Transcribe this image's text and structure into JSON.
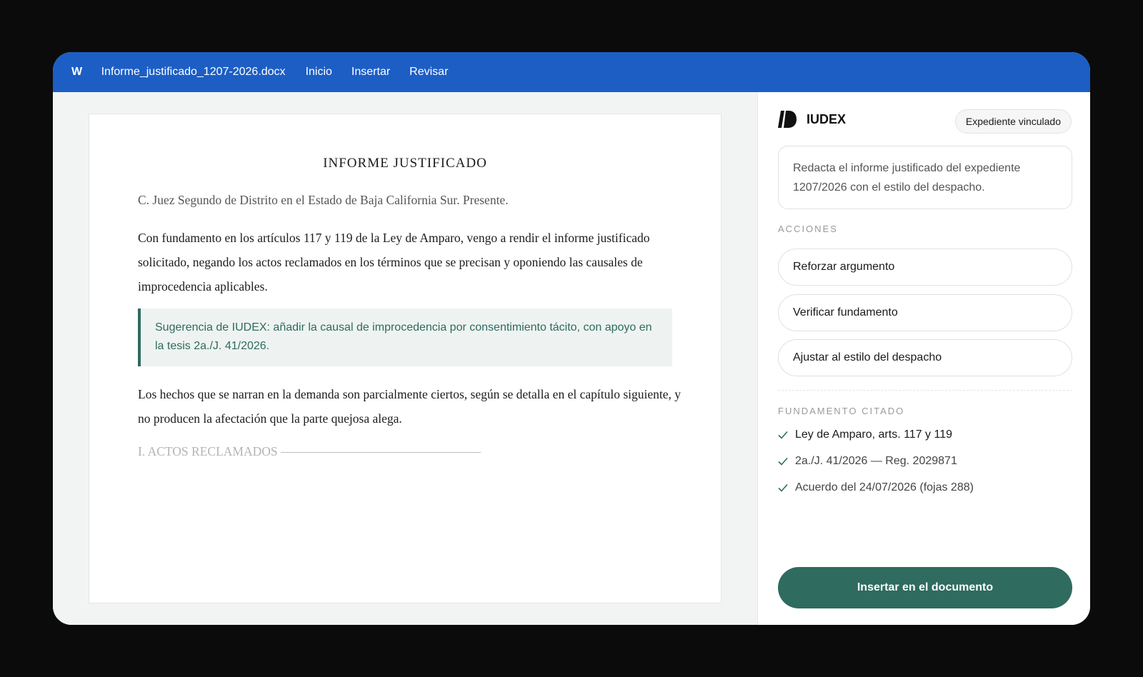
{
  "topbar": {
    "app_logo": "W",
    "filename": "Informe_justificado_1207-2026.docx",
    "menu": [
      "Inicio",
      "Insertar",
      "Revisar"
    ]
  },
  "document": {
    "title": "INFORME JUSTIFICADO",
    "addressee": "C. Juez Segundo de Distrito en el Estado de Baja California Sur. Presente.",
    "paragraph_1": "Con fundamento en los artículos 117 y 119 de la Ley de Amparo, vengo a rendir el informe justificado solicitado, negando los actos reclamados en los términos que se precisan y oponiendo las causales de improcedencia aplicables.",
    "suggestion": "Sugerencia de IUDEX: añadir la causal de improcedencia por consentimiento tácito, con apoyo en la tesis 2a./J. 41/2026.",
    "paragraph_2": "Los hechos que se narran en la demanda son parcialmente ciertos, según se detalla en el capítulo siguiente, y no producen la afectación que la parte quejosa alega.",
    "section_heading": "I. ACTOS RECLAMADOS ————————————————"
  },
  "sidebar": {
    "brand_name": "IUDEX",
    "linked_badge": "Expediente vinculado",
    "prompt": "Redacta el informe justificado del expediente 1207/2026 con el estilo del despacho.",
    "actions_label": "ACCIONES",
    "actions": [
      "Reforzar argumento",
      "Verificar fundamento",
      "Ajustar al estilo del despacho"
    ],
    "fundamento_label": "FUNDAMENTO CITADO",
    "citations": [
      "Ley de Amparo, arts. 117 y 119",
      "2a./J. 41/2026 — Reg. 2029871",
      "Acuerdo del 24/07/2026 (fojas 288)"
    ],
    "insert_button": "Insertar en el documento"
  },
  "colors": {
    "topbar": "#1c5ec4",
    "accent_green": "#2f6b5f",
    "doc_background": "#f1f4f3"
  },
  "icons": {
    "brand": "iudex-logo-icon",
    "check": "check-icon"
  }
}
